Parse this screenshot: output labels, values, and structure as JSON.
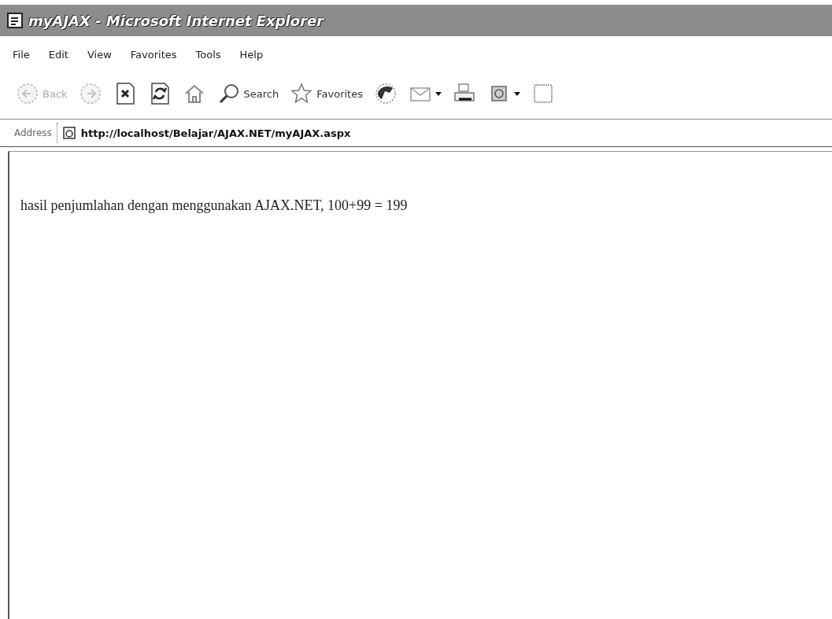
{
  "window": {
    "title": "myAJAX - Microsoft Internet Explorer"
  },
  "menu": [
    "File",
    "Edit",
    "View",
    "Favorites",
    "Tools",
    "Help"
  ],
  "toolbar": [
    {
      "kind": "back",
      "label": "Back",
      "disabled": true,
      "dropdown": false
    },
    {
      "kind": "forward",
      "disabled": true,
      "dropdown": false
    },
    {
      "kind": "stop",
      "disabled": false,
      "dropdown": false
    },
    {
      "kind": "refresh",
      "disabled": false,
      "dropdown": false
    },
    {
      "kind": "home",
      "disabled": false,
      "dropdown": false
    },
    {
      "kind": "search",
      "label": "Search",
      "disabled": false,
      "dropdown": false
    },
    {
      "kind": "favorites",
      "label": "Favorites",
      "disabled": false,
      "dropdown": false
    },
    {
      "kind": "media",
      "disabled": false,
      "dropdown": false
    },
    {
      "kind": "mail",
      "disabled": false,
      "dropdown": true
    },
    {
      "kind": "print",
      "disabled": false,
      "dropdown": false
    },
    {
      "kind": "edit",
      "disabled": false,
      "dropdown": true
    },
    {
      "kind": "blank",
      "disabled": false,
      "dropdown": false
    }
  ],
  "address": {
    "label": "Address",
    "value": "http://localhost/Belajar/AJAX.NET/myAJAX.aspx"
  },
  "page": {
    "text": "hasil penjumlahan dengan menggunakan AJAX.NET, 100+99 = 199"
  }
}
